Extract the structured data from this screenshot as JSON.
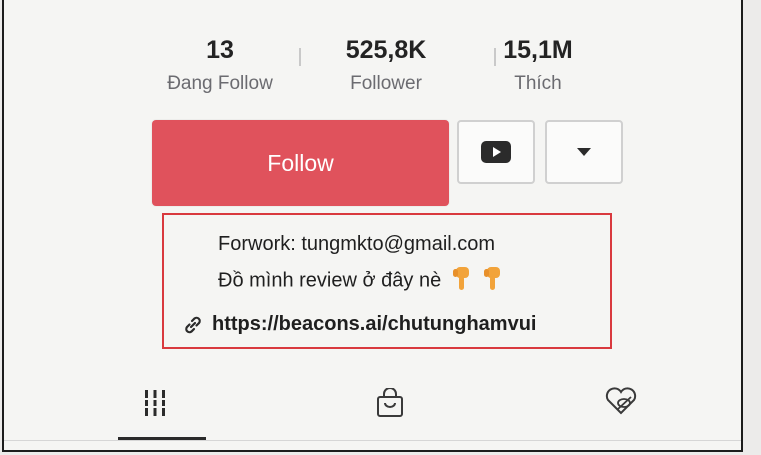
{
  "stats": [
    {
      "value": "13",
      "label": "Đang Follow"
    },
    {
      "value": "525,8K",
      "label": "Follower"
    },
    {
      "value": "15,1M",
      "label": "Thích"
    }
  ],
  "actions": {
    "follow_label": "Follow",
    "youtube_icon": "youtube-icon",
    "more_icon": "caret-down-icon"
  },
  "bio": {
    "line1": "Forwork: tungmkto@gmail.com",
    "line2": "Đồ mình review ở đây nè",
    "line2_emoji": "pointing-down-hand-icon x2",
    "link": "https://beacons.ai/chutunghamvui",
    "link_icon": "link-icon",
    "highlight_color": "#d9393e"
  },
  "tabs": [
    {
      "name": "videos",
      "icon": "grid-icon",
      "active": true
    },
    {
      "name": "shop",
      "icon": "shopping-bag-icon",
      "active": false
    },
    {
      "name": "liked",
      "icon": "hidden-heart-icon",
      "active": false
    }
  ],
  "colors": {
    "follow_button": "#e0525c",
    "text": "#232323",
    "muted": "#6b6b70"
  }
}
